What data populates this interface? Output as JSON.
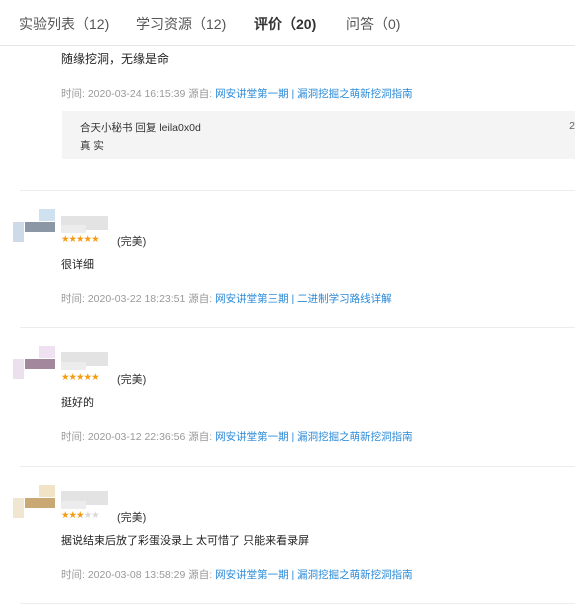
{
  "tabs": [
    {
      "label": "实验列表（12)"
    },
    {
      "label": "学习资源（12)"
    },
    {
      "label": "评价（20)"
    },
    {
      "label": "问答（0)"
    }
  ],
  "top_review": {
    "text": "随缘挖洞，无缘是命",
    "time_label": "时间:",
    "time": "2020-03-24 16:15:39",
    "source_label": "源自:",
    "course": "网安讲堂第一期 | 漏洞挖掘之萌新挖洞指南",
    "reply": {
      "author": "合天小秘书",
      "verb": "回复",
      "target": "leila0x0d",
      "text": "真 实",
      "cut": "2"
    }
  },
  "reviews": [
    {
      "stars": "★★★★★",
      "rating_label": "(完美)",
      "text": "很详细",
      "time_label": "时间:",
      "time": "2020-03-22 18:23:51",
      "source_label": "源自:",
      "course": "网安讲堂第三期 | 二进制学习路线详解"
    },
    {
      "stars": "★★★★★",
      "rating_label": "(完美)",
      "text": "挺好的",
      "time_label": "时间:",
      "time": "2020-03-12 22:36:56",
      "source_label": "源自:",
      "course": "网安讲堂第一期 | 漏洞挖掘之萌新挖洞指南"
    },
    {
      "stars_on": "★★★",
      "stars_off": "★★",
      "rating_label": "(完美)",
      "text": "据说结束后放了彩蛋没录上 太可惜了 只能来看录屏",
      "time_label": "时间:",
      "time": "2020-03-08 13:58:29",
      "source_label": "源自:",
      "course": "网安讲堂第一期 | 漏洞挖掘之萌新挖洞指南"
    }
  ],
  "colors": {
    "accent_link": "#2a8ad8",
    "star": "#f39c12",
    "reply_bg": "#f4f4f4"
  }
}
